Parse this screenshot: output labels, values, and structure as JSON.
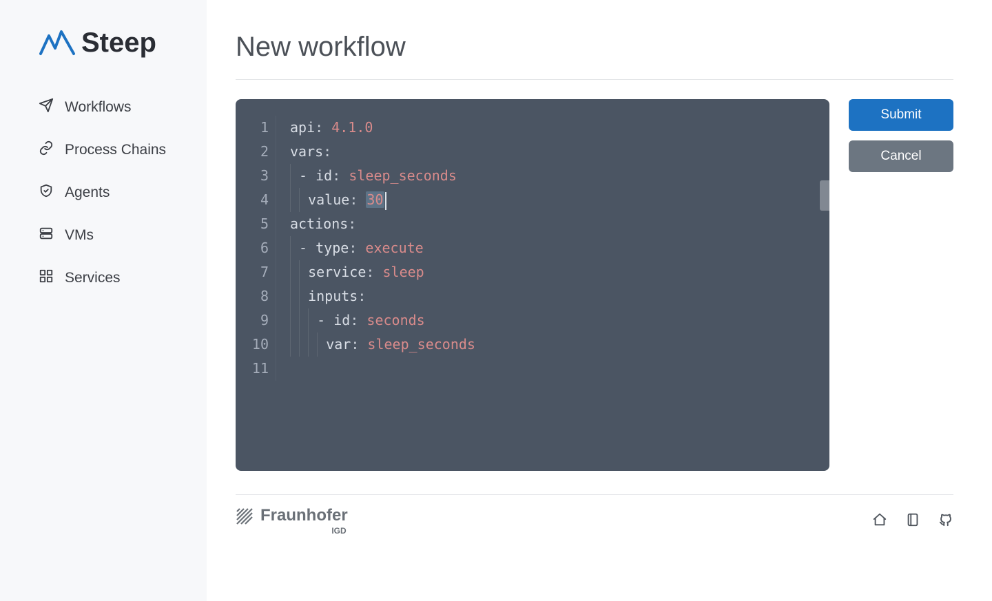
{
  "brand": {
    "name": "Steep"
  },
  "sidebar": {
    "items": [
      {
        "label": "Workflows",
        "icon": "paper-plane-icon"
      },
      {
        "label": "Process Chains",
        "icon": "chain-link-icon"
      },
      {
        "label": "Agents",
        "icon": "shield-icon"
      },
      {
        "label": "VMs",
        "icon": "server-icon"
      },
      {
        "label": "Services",
        "icon": "grid-icon"
      }
    ]
  },
  "page": {
    "title": "New workflow"
  },
  "editor": {
    "language": "yaml",
    "cursor": {
      "line": 4,
      "col": 15
    },
    "selection": {
      "line": 4,
      "value": "30"
    },
    "lines": [
      {
        "n": 1,
        "indent": 0,
        "key": "api",
        "value": "4.1.0"
      },
      {
        "n": 2,
        "indent": 0,
        "key": "vars",
        "value": ""
      },
      {
        "n": 3,
        "indent": 1,
        "dash": true,
        "key": "id",
        "value": "sleep_seconds"
      },
      {
        "n": 4,
        "indent": 2,
        "key": "value",
        "value": "30",
        "selected": true,
        "caret": true
      },
      {
        "n": 5,
        "indent": 0,
        "key": "actions",
        "value": ""
      },
      {
        "n": 6,
        "indent": 1,
        "dash": true,
        "key": "type",
        "value": "execute"
      },
      {
        "n": 7,
        "indent": 2,
        "key": "service",
        "value": "sleep"
      },
      {
        "n": 8,
        "indent": 2,
        "key": "inputs",
        "value": ""
      },
      {
        "n": 9,
        "indent": 3,
        "dash": true,
        "key": "id",
        "value": "seconds"
      },
      {
        "n": 10,
        "indent": 4,
        "key": "var",
        "value": "sleep_seconds"
      },
      {
        "n": 11,
        "indent": 0,
        "key": "",
        "value": ""
      }
    ]
  },
  "actions": {
    "submit": "Submit",
    "cancel": "Cancel"
  },
  "footer": {
    "org": "Fraunhofer",
    "sub": "IGD",
    "links": [
      {
        "name": "home-link",
        "icon": "home-icon"
      },
      {
        "name": "docs-link",
        "icon": "book-icon"
      },
      {
        "name": "github-link",
        "icon": "github-icon"
      }
    ]
  }
}
